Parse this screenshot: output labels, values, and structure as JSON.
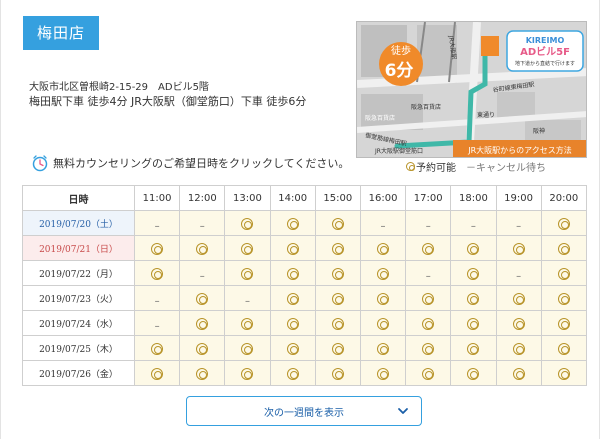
{
  "store": {
    "name": "梅田店"
  },
  "address": "大阪市北区曽根崎2-15-29　ADビル5階",
  "access": "梅田駅下車 徒歩4分 JR大阪駅（御堂筋口）下車 徒歩6分",
  "map": {
    "walk_label": "徒歩",
    "walk_minutes": "6分",
    "brand": "KIREIMO",
    "building": "ADビル5F",
    "building_note": "地下道から直結で行けます",
    "caption": "JR大阪駅からのアクセス方法",
    "labels": {
      "jr_osaka_station": "JR大阪駅",
      "jr_osaka_gate": "JR大阪駅御堂筋口",
      "midosuji_umeda": "御堂筋線梅田駅",
      "hankyu_west": "阪急百貨店",
      "hankyu_east": "阪急百貨店",
      "tanimachi": "谷町線東梅田駅",
      "higashi_dori": "東通り",
      "hanshin": "阪神"
    }
  },
  "notice": "無料カウンセリングのご希望日時をクリックしてください。",
  "legend": {
    "available": "予約可能",
    "waiting": "－キャンセル待ち"
  },
  "table": {
    "date_header": "日時",
    "times": [
      "11:00",
      "12:00",
      "13:00",
      "14:00",
      "15:00",
      "16:00",
      "17:00",
      "18:00",
      "19:00",
      "20:00"
    ],
    "rows": [
      {
        "date": "2019/07/20（土）",
        "day_type": "sat",
        "slots": [
          "-",
          "-",
          "o",
          "o",
          "o",
          "-",
          "-",
          "-",
          "-",
          "o"
        ]
      },
      {
        "date": "2019/07/21（日）",
        "day_type": "sun",
        "slots": [
          "o",
          "o",
          "o",
          "o",
          "o",
          "o",
          "o",
          "o",
          "o",
          "o"
        ]
      },
      {
        "date": "2019/07/22（月）",
        "day_type": "weekday",
        "slots": [
          "o",
          "-",
          "o",
          "o",
          "o",
          "o",
          "-",
          "o",
          "-",
          "o"
        ]
      },
      {
        "date": "2019/07/23（火）",
        "day_type": "weekday",
        "slots": [
          "-",
          "o",
          "-",
          "o",
          "o",
          "o",
          "o",
          "o",
          "o",
          "o"
        ]
      },
      {
        "date": "2019/07/24（水）",
        "day_type": "weekday",
        "slots": [
          "-",
          "o",
          "o",
          "o",
          "o",
          "o",
          "o",
          "o",
          "o",
          "o"
        ]
      },
      {
        "date": "2019/07/25（木）",
        "day_type": "weekday",
        "slots": [
          "o",
          "o",
          "o",
          "o",
          "o",
          "o",
          "o",
          "o",
          "o",
          "o"
        ]
      },
      {
        "date": "2019/07/26（金）",
        "day_type": "weekday",
        "slots": [
          "o",
          "o",
          "o",
          "o",
          "o",
          "o",
          "o",
          "o",
          "o",
          "o"
        ]
      }
    ]
  },
  "next_week_button": "次の一週間を表示",
  "colors": {
    "accent": "#35a0df",
    "slot_bg": "#fdf9e7",
    "gold": "#b8942a",
    "saturday_bg": "#eef4fb",
    "sunday_bg": "#fcecec"
  }
}
